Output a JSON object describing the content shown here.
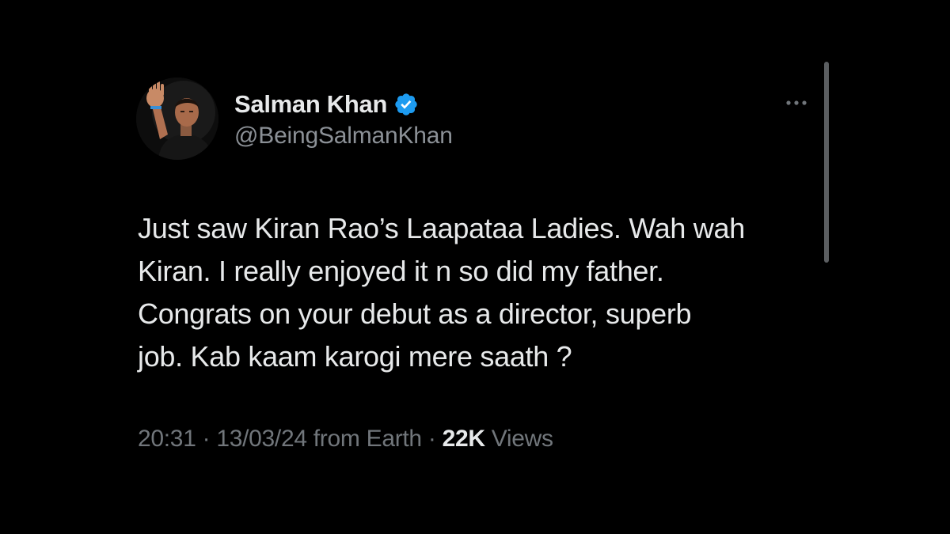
{
  "tweet": {
    "author": {
      "display_name": "Salman Khan",
      "handle": "@BeingSalmanKhan",
      "verified": true,
      "verified_icon": "verified-badge-icon",
      "avatar_icon": "profile-avatar"
    },
    "more_icon": "more-options-icon",
    "text_lines": [
      "Just saw Kiran Rao’s Laapataa Ladies. Wah wah",
      "Kiran. I really enjoyed it n so did my father.",
      "Congrats on your debut as a director, superb",
      "job. Kab kaam karogi mere saath ?"
    ],
    "meta": {
      "time": "20:31",
      "separator": " · ",
      "date": "13/03/24",
      "source": " from Earth",
      "views_count": "22K",
      "views_label": " Views"
    }
  },
  "colors": {
    "background": "#000000",
    "primary_text": "#e7e9ea",
    "secondary_text": "#71767b",
    "verified_blue": "#1d9bf0"
  }
}
